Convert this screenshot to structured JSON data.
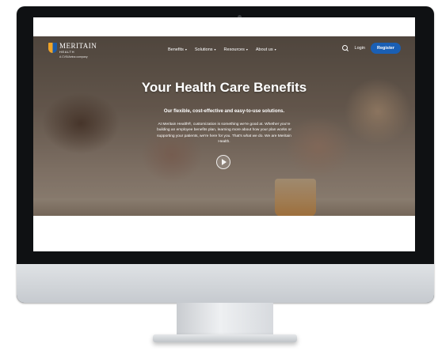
{
  "site": {
    "logo": {
      "name": "MERITAIN",
      "sub": "HEALTH",
      "tagline": "A CVS/Aetna company"
    },
    "nav": [
      {
        "label": "Benefits"
      },
      {
        "label": "Solutions"
      },
      {
        "label": "Resources"
      },
      {
        "label": "About us"
      }
    ],
    "login_label": "Login",
    "register_label": "Register",
    "hero": {
      "headline": "Your Health Care Benefits",
      "subhead": "Our flexible, cost-effective and easy-to-use solutions.",
      "body": "At Meritain Health®, customization is something we're good at. Whether you're building an employee benefits plan, learning more about how your plan works or supporting your patients, we're here for you. That's what we do. We are Meritain Health."
    }
  },
  "colors": {
    "accent": "#1a5fb4",
    "logo_orange": "#f0a428",
    "logo_blue": "#1c5aa6",
    "bezel": "#0f1113"
  }
}
